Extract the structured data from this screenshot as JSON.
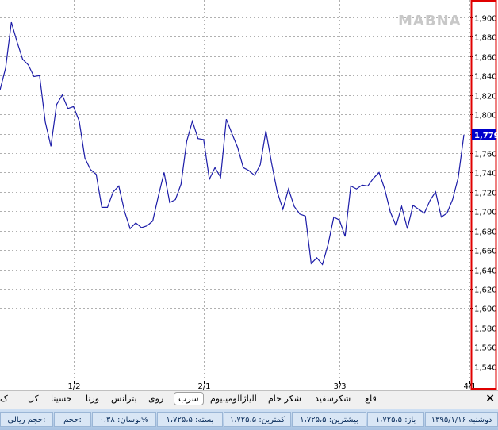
{
  "watermark": "MABNA",
  "chart_data": {
    "type": "line",
    "ylim": [
      1525,
      1918
    ],
    "y_ticks": [
      "1,540",
      "1,560",
      "1,580",
      "1,600",
      "1,620",
      "1,640",
      "1,660",
      "1,680",
      "1,700",
      "1,720",
      "1,740",
      "1,760",
      "1,780",
      "1,800",
      "1,820",
      "1,840",
      "1,860",
      "1,880",
      "1,900"
    ],
    "y_tick_values": [
      1540,
      1560,
      1580,
      1600,
      1620,
      1640,
      1660,
      1680,
      1700,
      1720,
      1740,
      1760,
      1780,
      1800,
      1820,
      1840,
      1860,
      1880,
      1900
    ],
    "x_ticks": [
      {
        "label": "1/2",
        "index": 13
      },
      {
        "label": "2/1",
        "index": 36
      },
      {
        "label": "3/3",
        "index": 60
      },
      {
        "label": "4/1",
        "index": 83
      }
    ],
    "last_value_label": "1,779",
    "line_color": "#1c1ca8",
    "highlight_color": "#0000cc",
    "values": [
      1825,
      1848,
      1895,
      1875,
      1857,
      1851,
      1839,
      1840,
      1792,
      1767,
      1810,
      1820,
      1806,
      1808,
      1793,
      1755,
      1743,
      1738,
      1704,
      1704,
      1720,
      1726,
      1700,
      1682,
      1688,
      1683,
      1685,
      1690,
      1716,
      1740,
      1709,
      1712,
      1728,
      1772,
      1793,
      1775,
      1774,
      1733,
      1745,
      1735,
      1795,
      1780,
      1766,
      1745,
      1742,
      1737,
      1748,
      1783,
      1750,
      1720,
      1702,
      1723,
      1705,
      1697,
      1695,
      1646,
      1652,
      1645,
      1666,
      1694,
      1691,
      1674,
      1726,
      1723,
      1727,
      1726,
      1734,
      1740,
      1723,
      1699,
      1685,
      1705,
      1682,
      1706,
      1702,
      1698,
      1711,
      1720,
      1694,
      1698,
      1712,
      1735,
      1779
    ]
  },
  "tabs": {
    "items": [
      {
        "label": "قلع",
        "active": false
      },
      {
        "label": "شکرسفید",
        "active": false
      },
      {
        "label": "شکر خام",
        "active": false
      },
      {
        "label": "آلیاژآلومینیوم",
        "active": false
      },
      {
        "label": "سرب",
        "active": true
      },
      {
        "label": "روی",
        "active": false
      },
      {
        "label": "بترانس",
        "active": false
      },
      {
        "label": "ورنا",
        "active": false
      },
      {
        "label": "حسینا",
        "active": false
      },
      {
        "label": "کل",
        "active": false
      },
      {
        "label": "ک",
        "active": false
      }
    ],
    "close_label": "×"
  },
  "status": {
    "cells": [
      "دوشنبه ۱۳۹۵/۱/۱۶",
      "باز: ۱،۷۲۵،۵",
      "بیشترین: ۱،۷۲۵،۵",
      "کمترین: ۱،۷۲۵،۵",
      "بسته: ۱،۷۲۵،۵",
      "نوسان: ۰،۳۸%",
      "حجم:",
      "حجم ریالی:"
    ]
  }
}
